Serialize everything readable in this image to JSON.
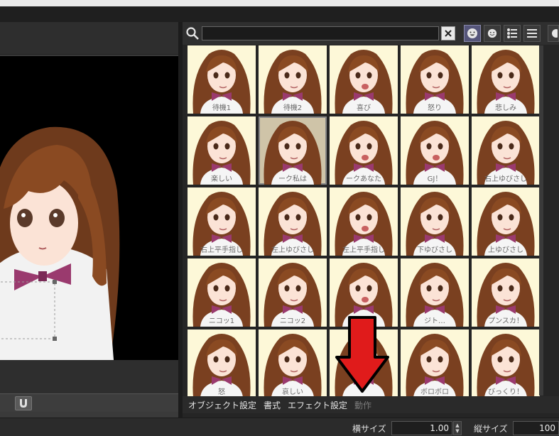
{
  "search": {
    "value": "",
    "placeholder": ""
  },
  "view_buttons": [
    "face-view-icon",
    "small-face-view-icon",
    "list-icon",
    "menu-icon"
  ],
  "expressions": [
    {
      "label": "待機1"
    },
    {
      "label": "待機2"
    },
    {
      "label": "喜び"
    },
    {
      "label": "怒り"
    },
    {
      "label": "悲しみ"
    },
    {
      "label": "楽しい"
    },
    {
      "label": "ーク私は"
    },
    {
      "label": "ークあなた"
    },
    {
      "label": "GJ！"
    },
    {
      "label": "右上ゆびさし"
    },
    {
      "label": "右上平手指し"
    },
    {
      "label": "左上ゆびさし"
    },
    {
      "label": "左上平手指し"
    },
    {
      "label": "下ゆびさし"
    },
    {
      "label": "上ゆびさし"
    },
    {
      "label": "ニコッ1"
    },
    {
      "label": "ニコッ2"
    },
    {
      "label": ""
    },
    {
      "label": "ジト…"
    },
    {
      "label": "プンスカ！"
    },
    {
      "label": "怒"
    },
    {
      "label": "哀しい"
    },
    {
      "label": ""
    },
    {
      "label": "ボロボロ"
    },
    {
      "label": "びっくり！"
    }
  ],
  "tabs": [
    {
      "label": "オブジェクト設定",
      "active": false
    },
    {
      "label": "書式",
      "active": false
    },
    {
      "label": "エフェクト設定",
      "active": false
    },
    {
      "label": "動作",
      "active": true
    }
  ],
  "bottom": {
    "width_label": "横サイズ",
    "width_value": "1.00",
    "height_label": "縦サイズ",
    "height_value": "100"
  },
  "colors": {
    "arrow": "#e01b1b",
    "thumb_bg": "#fdf8d8",
    "hair": "#7a4020",
    "bow": "#9a3a6e"
  }
}
